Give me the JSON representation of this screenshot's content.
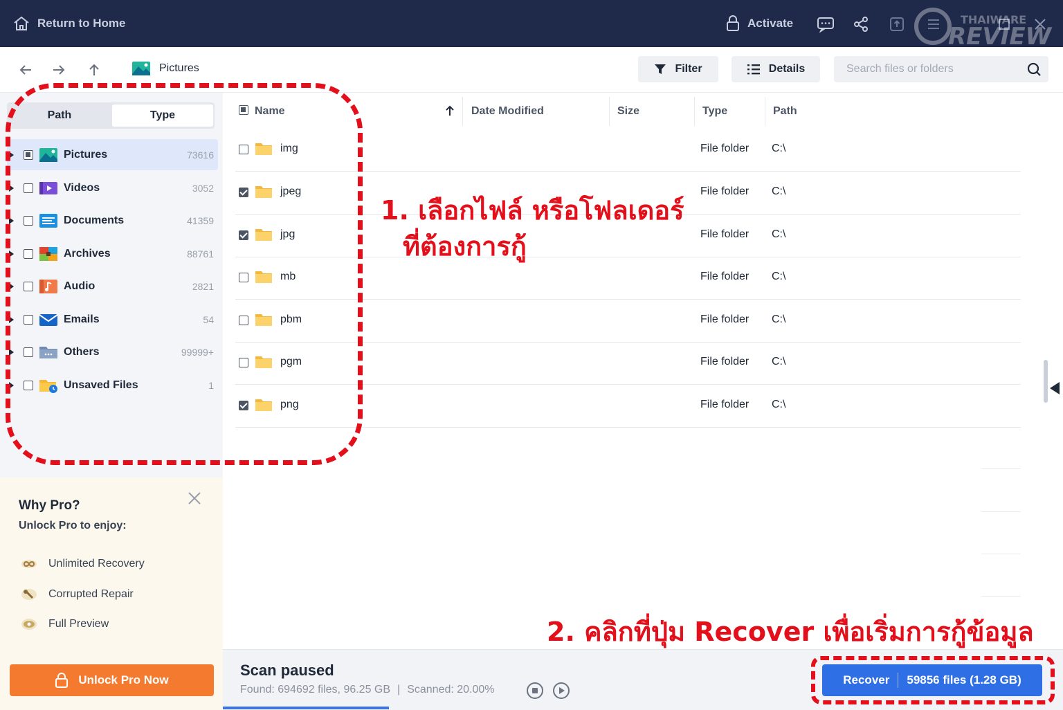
{
  "titlebar": {
    "home_label": "Return to Home",
    "activate_label": "Activate",
    "watermark": "THAIWARE REVIEW"
  },
  "toolbar": {
    "breadcrumb": "Pictures",
    "filter_label": "Filter",
    "details_label": "Details",
    "search_placeholder": "Search files or folders"
  },
  "sidebar": {
    "tabs": [
      {
        "label": "Path",
        "active": false
      },
      {
        "label": "Type",
        "active": true
      }
    ],
    "categories": [
      {
        "label": "Pictures",
        "count": "73616",
        "icon": "pictures-icon",
        "state": "partial",
        "selected": true
      },
      {
        "label": "Videos",
        "count": "3052",
        "icon": "videos-icon",
        "state": "unchecked"
      },
      {
        "label": "Documents",
        "count": "41359",
        "icon": "documents-icon",
        "state": "unchecked"
      },
      {
        "label": "Archives",
        "count": "88761",
        "icon": "archives-icon",
        "state": "unchecked"
      },
      {
        "label": "Audio",
        "count": "2821",
        "icon": "audio-icon",
        "state": "unchecked"
      },
      {
        "label": "Emails",
        "count": "54",
        "icon": "emails-icon",
        "state": "unchecked"
      },
      {
        "label": "Others",
        "count": "99999+",
        "icon": "others-icon",
        "state": "unchecked"
      },
      {
        "label": "Unsaved Files",
        "count": "1",
        "icon": "unsaved-files-icon",
        "state": "unchecked"
      }
    ]
  },
  "pro": {
    "title": "Why Pro?",
    "subtitle": "Unlock Pro to enjoy:",
    "features": [
      "Unlimited Recovery",
      "Corrupted Repair",
      "Full Preview"
    ],
    "button_label": "Unlock Pro Now"
  },
  "table": {
    "columns": [
      "Name",
      "Date Modified",
      "Size",
      "Type",
      "Path"
    ],
    "rows": [
      {
        "name": "img",
        "type": "File folder",
        "path": "C:\\",
        "checked": false
      },
      {
        "name": "jpeg",
        "type": "File folder",
        "path": "C:\\",
        "checked": true
      },
      {
        "name": "jpg",
        "type": "File folder",
        "path": "C:\\",
        "checked": true
      },
      {
        "name": "mb",
        "type": "File folder",
        "path": "C:\\",
        "checked": false
      },
      {
        "name": "pbm",
        "type": "File folder",
        "path": "C:\\",
        "checked": false
      },
      {
        "name": "pgm",
        "type": "File folder",
        "path": "C:\\",
        "checked": false
      },
      {
        "name": "png",
        "type": "File folder",
        "path": "C:\\",
        "checked": true
      }
    ]
  },
  "status": {
    "title": "Scan paused",
    "found": "Found: 694692 files, 96.25 GB",
    "divider": "|",
    "scanned": "Scanned: 20.00%",
    "progress_fraction": 0.2
  },
  "recover": {
    "label": "Recover",
    "summary": "59856 files (1.28 GB)"
  },
  "annotations": {
    "step1_line1": "1. เลือกไฟล์ หรือโฟลเดอร์",
    "step1_line2": "ที่ต้องการกู้",
    "step2": "2. คลิกที่ปุ่ม Recover เพื่อเริ่มการกู้ข้อมูล"
  },
  "colors": {
    "titlebar": "#1f2a4a",
    "accent": "#2f6fe6",
    "pro_button": "#f47a2f",
    "annotation": "#e3101c"
  }
}
